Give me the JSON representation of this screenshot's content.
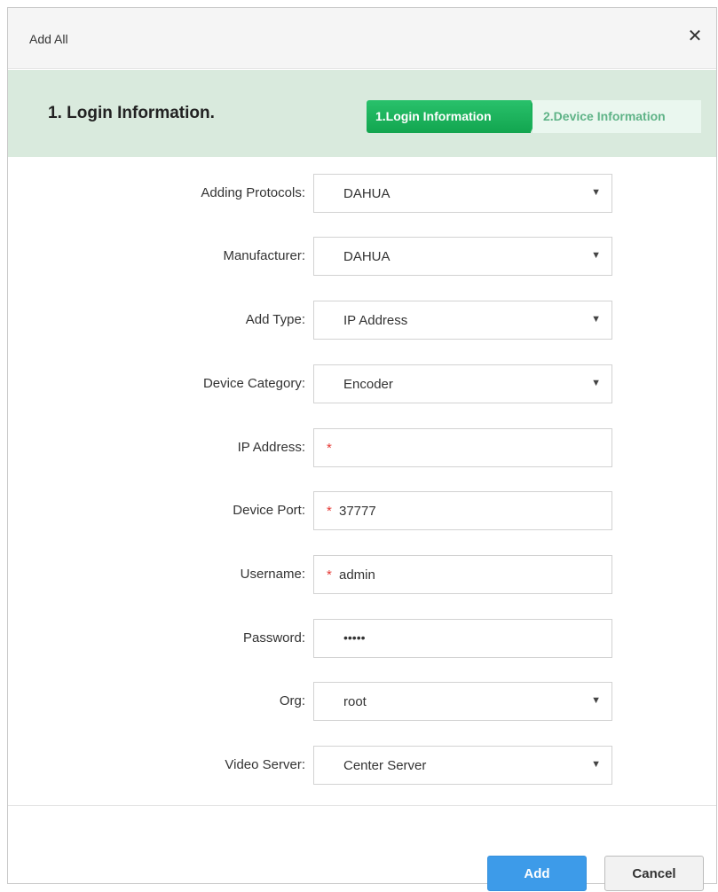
{
  "dialog": {
    "title": "Add All",
    "close_glyph": "✕"
  },
  "stepbar": {
    "heading": "1.  Login Information.",
    "steps": [
      {
        "label": "1.Login Information",
        "active": true
      },
      {
        "label": "2.Device Information",
        "active": false
      }
    ],
    "active_color": "#1ab15a"
  },
  "form": {
    "adding_protocols": {
      "label": "Adding Protocols:",
      "value": "DAHUA"
    },
    "manufacturer": {
      "label": "Manufacturer:",
      "value": "DAHUA"
    },
    "add_type": {
      "label": "Add Type:",
      "value": "IP Address"
    },
    "device_category": {
      "label": "Device Category:",
      "value": "Encoder"
    },
    "ip_address": {
      "label": "IP Address:",
      "value": "",
      "required_mark": "*"
    },
    "device_port": {
      "label": "Device Port:",
      "value": "37777",
      "required_mark": "*"
    },
    "username": {
      "label": "Username:",
      "value": "admin",
      "required_mark": "*"
    },
    "password": {
      "label": "Password:",
      "value": "•••••"
    },
    "org": {
      "label": "Org:",
      "value": "root"
    },
    "video_server": {
      "label": "Video Server:",
      "value": "Center Server"
    },
    "caret_glyph": "▼"
  },
  "footer": {
    "add_label": "Add",
    "cancel_label": "Cancel",
    "primary_color": "#3d9be9"
  }
}
